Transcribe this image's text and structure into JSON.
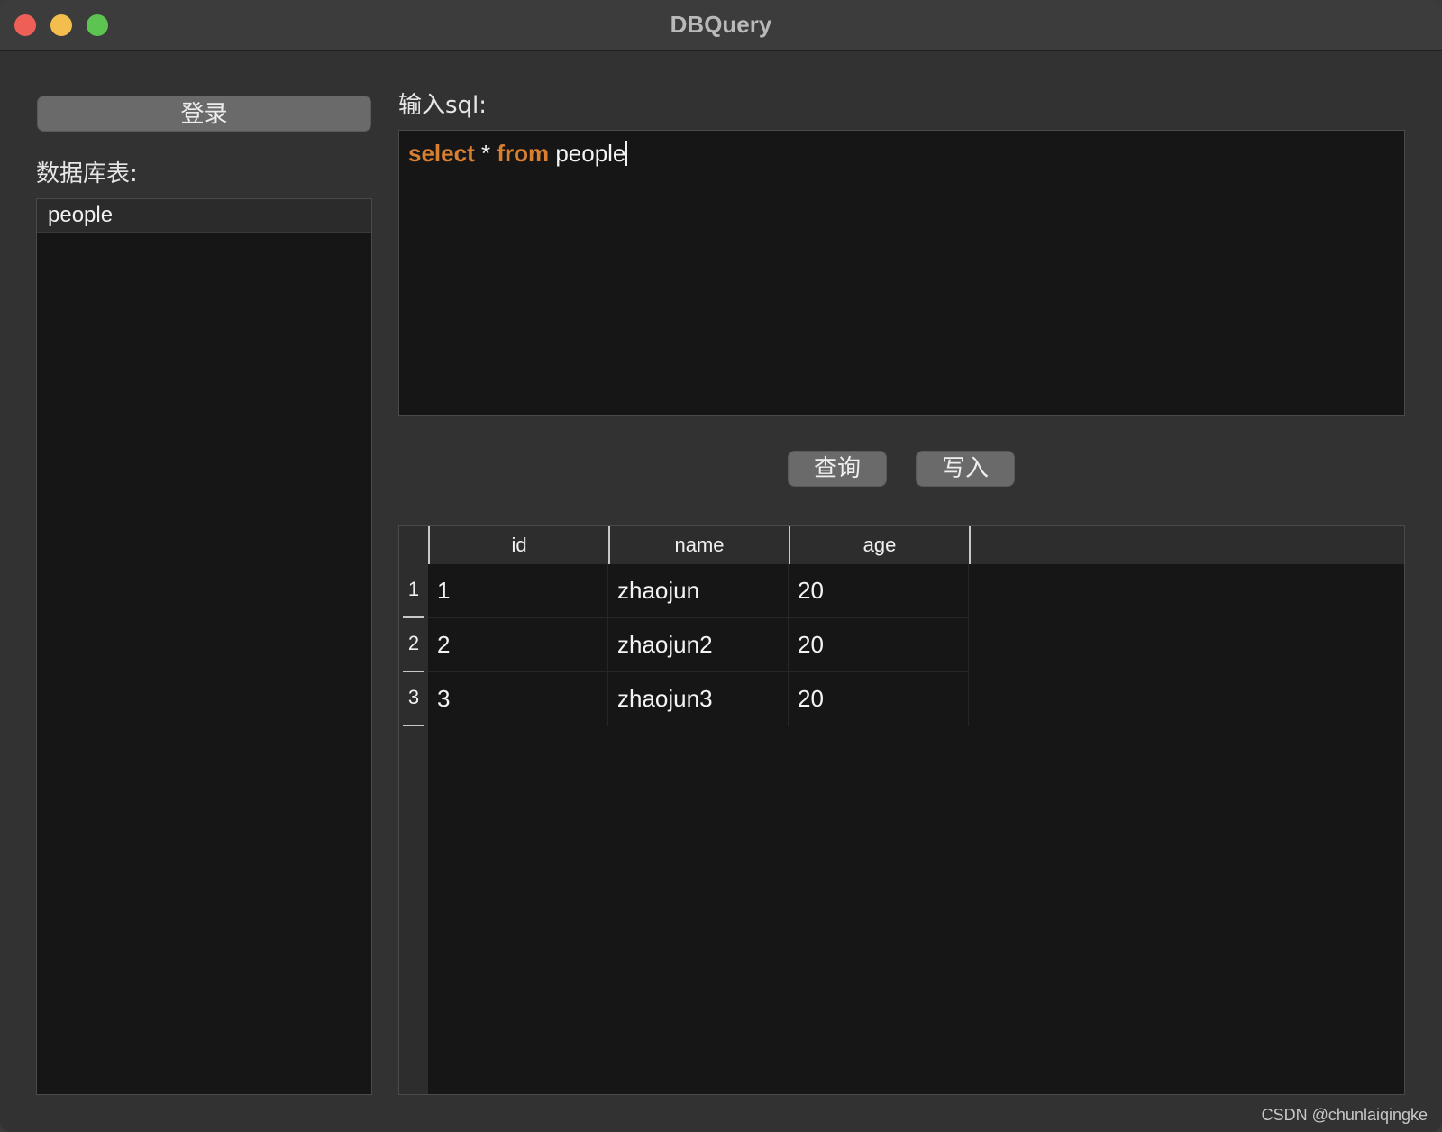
{
  "window": {
    "title": "DBQuery"
  },
  "sidebar": {
    "login_label": "登录",
    "tables_label": "数据库表:",
    "tables": [
      "people"
    ]
  },
  "editor": {
    "label": "输入sql:",
    "tokens": {
      "kw1": "select",
      "star": " * ",
      "kw2": "from",
      "ident": " people"
    }
  },
  "actions": {
    "query_label": "查询",
    "write_label": "写入"
  },
  "results": {
    "columns": [
      "id",
      "name",
      "age"
    ],
    "rows": [
      {
        "num": "1",
        "cells": [
          "1",
          "zhaojun",
          "20"
        ]
      },
      {
        "num": "2",
        "cells": [
          "2",
          "zhaojun2",
          "20"
        ]
      },
      {
        "num": "3",
        "cells": [
          "3",
          "zhaojun3",
          "20"
        ]
      }
    ]
  },
  "watermark": "CSDN @chunlaiqingke",
  "colors": {
    "keyword": "#d97f31",
    "close": "#ee5f57",
    "minimize": "#f4be4f",
    "zoom": "#5dc452"
  }
}
